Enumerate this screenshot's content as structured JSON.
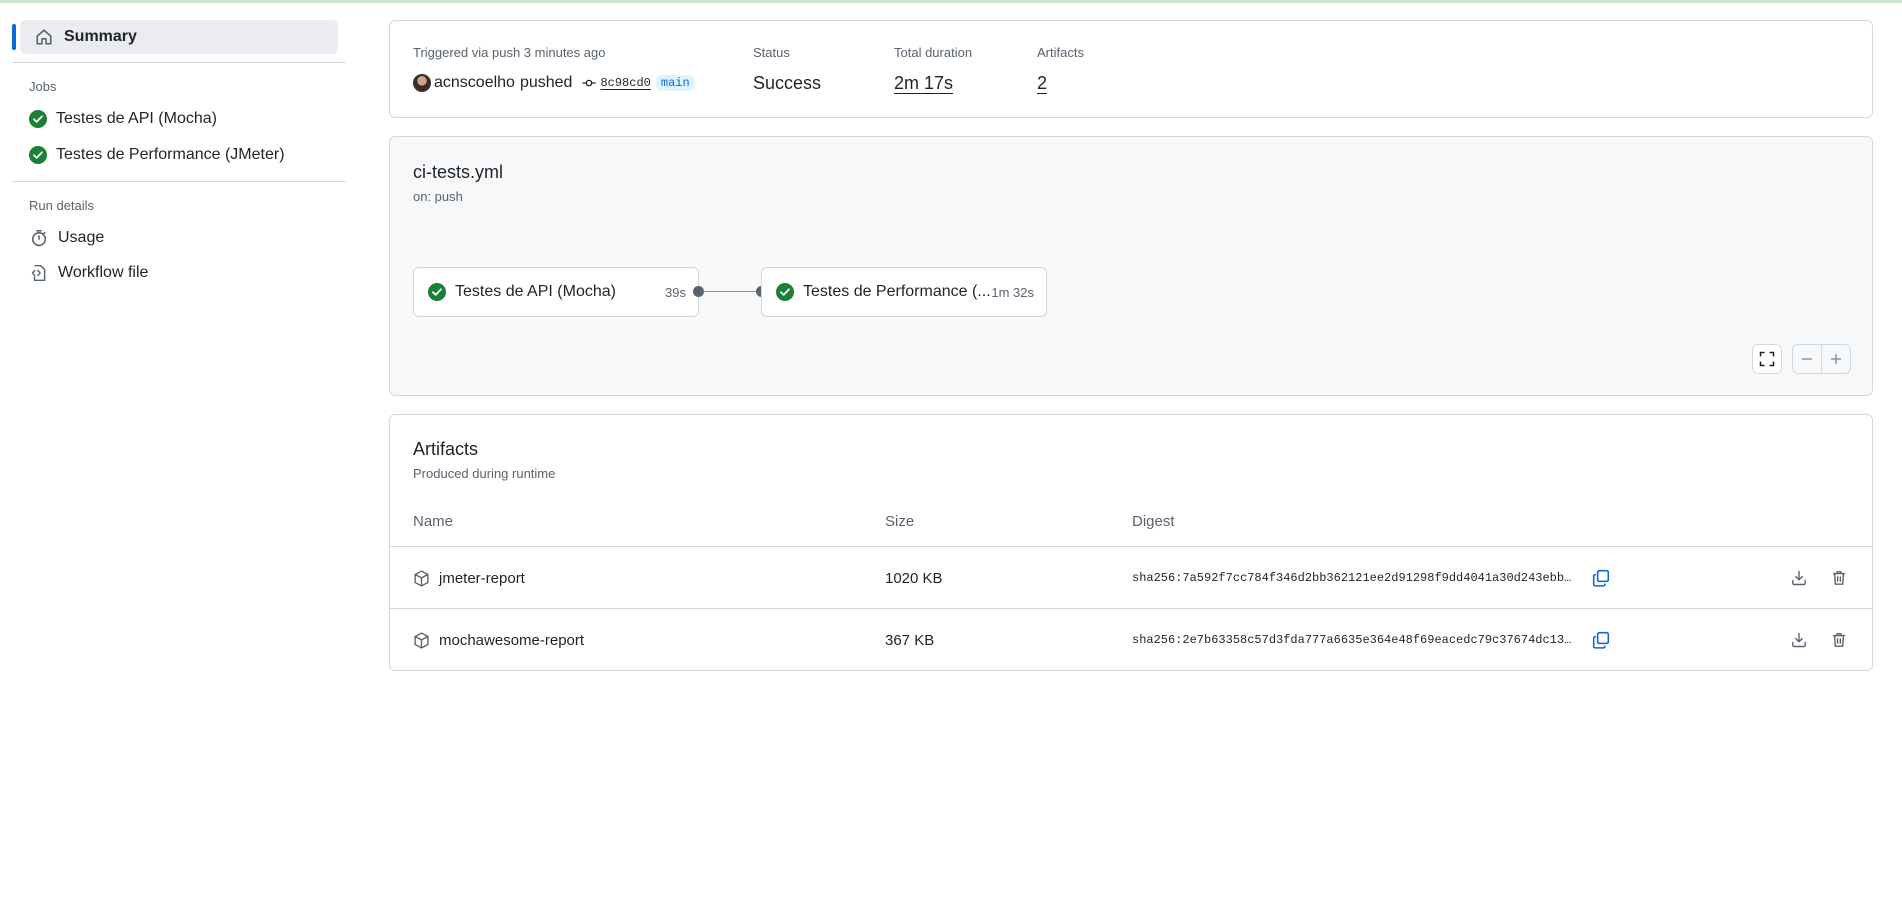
{
  "sidebar": {
    "summary_label": "Summary",
    "jobs_heading": "Jobs",
    "jobs": [
      {
        "label": "Testes de API (Mocha)",
        "status": "success"
      },
      {
        "label": "Testes de Performance (JMeter)",
        "status": "success"
      }
    ],
    "run_details_heading": "Run details",
    "run_details": [
      {
        "label": "Usage",
        "icon": "stopwatch-icon"
      },
      {
        "label": "Workflow file",
        "icon": "file-code-icon"
      }
    ]
  },
  "summary": {
    "trigger_label": "Triggered via push 3 minutes ago",
    "actor": "acnscoelho",
    "action": "pushed",
    "commit_sha": "8c98cd0",
    "branch": "main",
    "status_label": "Status",
    "status_value": "Success",
    "duration_label": "Total duration",
    "duration_value": "2m 17s",
    "artifacts_label": "Artifacts",
    "artifacts_value": "2"
  },
  "workflow": {
    "file": "ci-tests.yml",
    "trigger": "on: push",
    "jobs": [
      {
        "label": "Testes de API (Mocha)",
        "duration": "39s",
        "status": "success"
      },
      {
        "label": "Testes de Performance (...",
        "duration": "1m 32s",
        "status": "success"
      }
    ]
  },
  "artifacts": {
    "title": "Artifacts",
    "subtitle": "Produced during runtime",
    "columns": [
      "Name",
      "Size",
      "Digest"
    ],
    "rows": [
      {
        "name": "jmeter-report",
        "size": "1020 KB",
        "digest": "sha256:7a592f7cc784f346d2bb362121ee2d91298f9dd4041a30d243ebb…"
      },
      {
        "name": "mochawesome-report",
        "size": "367 KB",
        "digest": "sha256:2e7b63358c57d3fda777a6635e364e48f69eacedc79c37674dc13…"
      }
    ]
  },
  "colors": {
    "accent": "#0969da",
    "success": "#1a7f37",
    "border": "#d1d9e0",
    "muted": "#59636e"
  }
}
